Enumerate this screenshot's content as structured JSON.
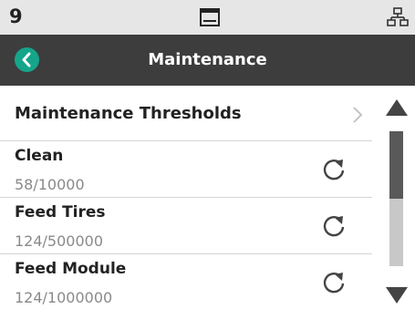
{
  "status": {
    "number": "9",
    "device_icon": "device-monitor-icon",
    "network_icon": "network-icon"
  },
  "header": {
    "title": "Maintenance",
    "back_icon": "back-icon",
    "accent_color": "#15a58b"
  },
  "thresholds_row": {
    "label": "Maintenance Thresholds",
    "icon": "chevron-right-icon"
  },
  "items": [
    {
      "name": "Clean",
      "count": "58/10000",
      "icon": "reset-icon"
    },
    {
      "name": "Feed Tires",
      "count": "124/500000",
      "icon": "reset-icon"
    },
    {
      "name": "Feed Module",
      "count": "124/1000000",
      "icon": "reset-icon"
    }
  ],
  "scroll": {
    "up_icon": "scroll-up-icon",
    "down_icon": "scroll-down-icon",
    "position_fraction": 0.0,
    "visible_fraction": 0.5
  }
}
